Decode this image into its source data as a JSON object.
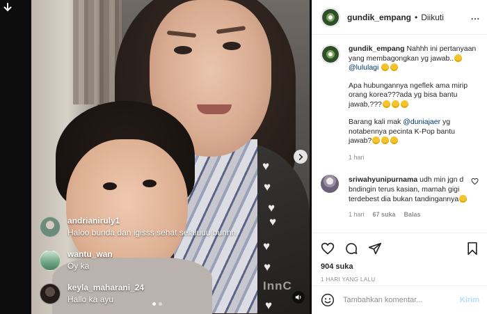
{
  "header": {
    "username": "gundik_empang",
    "separator": "•",
    "follow_status": "Diikuti",
    "more": "..."
  },
  "caption": {
    "username": "gundik_empang",
    "line1_text": "Nahhh ini pertanyaan yang membagongkan yg jawab..",
    "line1_mention": "@lululagi",
    "line2_text": "Apa hubungannya ngeflek ama mirip orang korea???ada yg bisa bantu jawab,???",
    "line3_prefix": "Barang kali mak",
    "line3_mention": "@duniajaer",
    "line3_suffix": "yg notabennya pecinta K-Pop bantu jawab?",
    "time": "1 hari"
  },
  "comment": {
    "username": "sriwahyunipurnama",
    "text": "udh min jgn d bndingin terus kasian, mamah gigi terdebest dia bukan tandingannya",
    "time": "1 hari",
    "likes": "67 suka",
    "reply": "Balas"
  },
  "actions": {
    "likes": "904 suka",
    "date": "1 HARI YANG LALU"
  },
  "add_comment": {
    "placeholder": "Tambahkan komentar...",
    "post": "Kirim"
  },
  "live_comments": [
    {
      "user": "andrianiruly1",
      "text": "Haloo bunda dan igisss sehat selaluuu bunnn"
    },
    {
      "user": "wantu_wan",
      "text": "Oy ka"
    },
    {
      "user": "keyla_maharani_24",
      "text": "Hallo ka ayu"
    }
  ],
  "watermark": "InnC",
  "icons": {
    "download": "download-arrow-icon",
    "next": "chevron-right-icon",
    "sound": "sound-icon",
    "like": "heart-icon",
    "comment": "speech-bubble-icon",
    "share": "paper-plane-icon",
    "save": "bookmark-icon",
    "emoji": "smiley-icon"
  }
}
